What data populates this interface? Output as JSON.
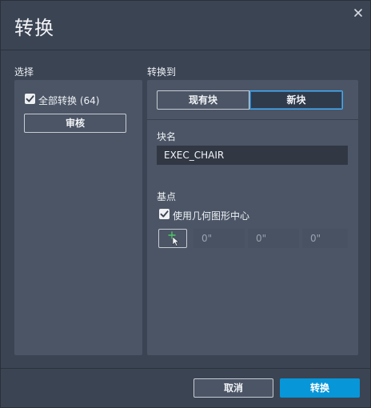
{
  "dialog": {
    "title": "转换",
    "close_icon": "close-icon"
  },
  "selection": {
    "label": "选择",
    "convert_all_label": "全部转换 (64)",
    "convert_all_checked": true,
    "review_button": "审核"
  },
  "convert_to": {
    "label": "转换到",
    "existing_block": "现有块",
    "new_block": "新块",
    "selected": "新块"
  },
  "block_name": {
    "label": "块名",
    "value": "EXEC_CHAIR"
  },
  "base_point": {
    "label": "基点",
    "use_center_label": "使用几何图形中心",
    "use_center_checked": true,
    "pick_icon": "pick-point-icon",
    "x": "0\"",
    "y": "0\"",
    "z": "0\""
  },
  "footer": {
    "cancel": "取消",
    "convert": "转换"
  },
  "colors": {
    "background": "#3b4453",
    "panel": "#4b5565",
    "accent": "#0796d8",
    "field": "#313844"
  }
}
